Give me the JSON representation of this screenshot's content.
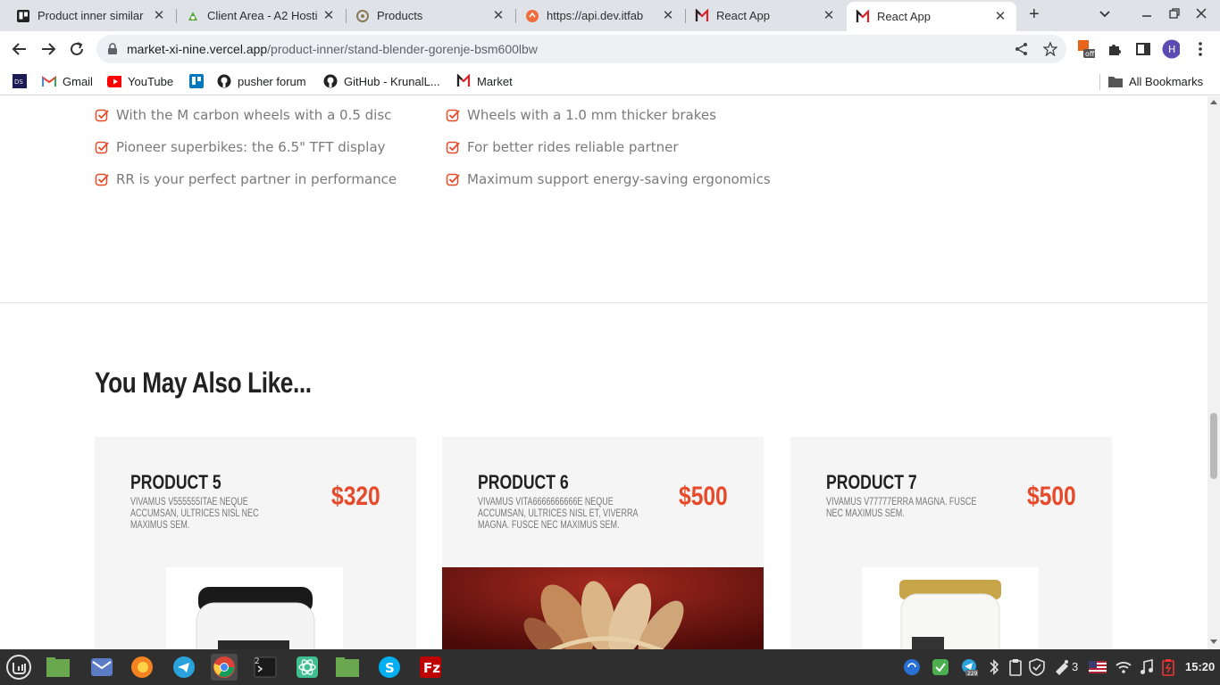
{
  "browser": {
    "tabs": [
      {
        "title": "Product inner similar",
        "icon": "trello-icon"
      },
      {
        "title": "Client Area - A2 Hosti",
        "icon": "a2-hosting-icon"
      },
      {
        "title": "Products",
        "icon": "gear-icon"
      },
      {
        "title": "https://api.dev.itfab",
        "icon": "swagger-icon"
      },
      {
        "title": "React App",
        "icon": "market-logo-icon"
      },
      {
        "title": "React App",
        "icon": "market-logo-icon"
      }
    ],
    "url_host": "market-xi-nine.vercel.app",
    "url_path": "/product-inner/stand-blender-gorenje-bsm600lbw",
    "profile_initial": "H",
    "extension_badge": "off",
    "bookmarks": [
      {
        "label": "",
        "icon": "ds-icon"
      },
      {
        "label": "Gmail",
        "icon": "gmail-icon"
      },
      {
        "label": "YouTube",
        "icon": "youtube-icon"
      },
      {
        "label": "",
        "icon": "trello-icon"
      },
      {
        "label": "pusher forum",
        "icon": "github-icon"
      },
      {
        "label": "GitHub - KrunalL...",
        "icon": "github-icon"
      },
      {
        "label": "Market",
        "icon": "market-logo-icon"
      }
    ],
    "all_bookmarks": "All Bookmarks"
  },
  "features": {
    "left": [
      "With the M carbon wheels with a 0.5 disc",
      "Pioneer superbikes: the 6.5\" TFT display",
      "RR is your perfect partner in performance"
    ],
    "right": [
      "Wheels with a 1.0 mm thicker brakes",
      "For better rides reliable partner",
      "Maximum support energy-saving ergonomics"
    ]
  },
  "related": {
    "title": "You May Also Like...",
    "products": [
      {
        "name": "PRODUCT 5",
        "description": "VIVAMUS V555555ITAE NEQUE ACCUMSAN, ULTRICES NISL NEC MAXIMUS SEM.",
        "price": "$320",
        "image": "jar-black-lid"
      },
      {
        "name": "PRODUCT 6",
        "description": "VIVAMUS VITA6666666666E NEQUE ACCUMSAN, ULTRICES NISL ET, VIVERRA MAGNA. FUSCE NEC MAXIMUS SEM.",
        "price": "$500",
        "image": "cured-meats"
      },
      {
        "name": "PRODUCT 7",
        "description": "VIVAMUS V77777ERRA MAGNA. FUSCE NEC MAXIMUS SEM.",
        "price": "$500",
        "image": "jar-gold-lid"
      }
    ]
  },
  "taskbar": {
    "apps": [
      "mint-menu-icon",
      "files-icon",
      "mail-icon",
      "firefox-icon",
      "telegram-icon",
      "chrome-icon",
      "terminal-icon",
      "atom-icon",
      "folder-icon",
      "skype-icon",
      "filezilla-icon"
    ],
    "terminal_badge": "2",
    "telegram_badge": "229",
    "notifications_count": "3",
    "time": "15:20"
  }
}
